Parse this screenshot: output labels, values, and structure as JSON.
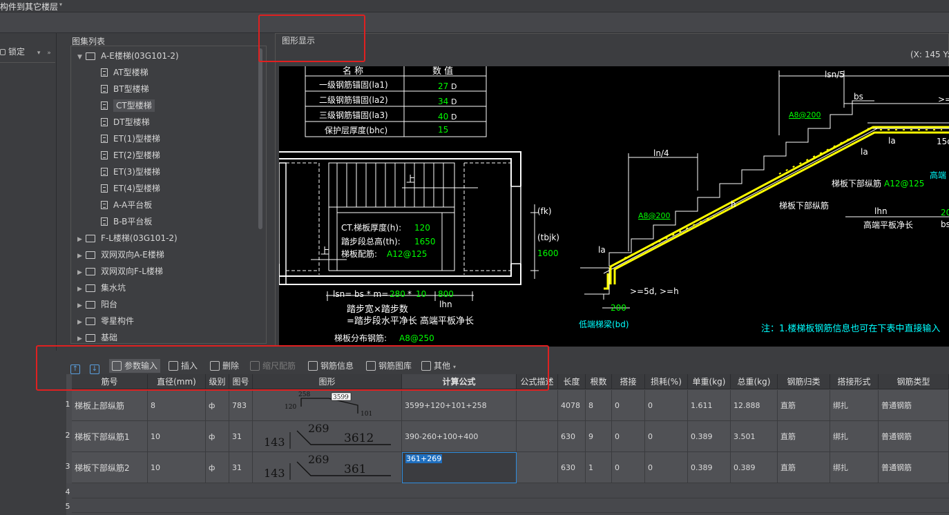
{
  "topbar": {
    "title": "构件到其它楼层"
  },
  "left": {
    "lock_label": "锁定"
  },
  "tree": {
    "title": "图集列表",
    "items": [
      {
        "label": "A-E楼梯(03G101-2)",
        "kind": "folder",
        "expanded": true
      },
      {
        "label": "AT型楼梯",
        "kind": "doc"
      },
      {
        "label": "BT型楼梯",
        "kind": "doc"
      },
      {
        "label": "CT型楼梯",
        "kind": "doc",
        "selected": true
      },
      {
        "label": "DT型楼梯",
        "kind": "doc"
      },
      {
        "label": "ET(1)型楼梯",
        "kind": "doc"
      },
      {
        "label": "ET(2)型楼梯",
        "kind": "doc"
      },
      {
        "label": "ET(3)型楼梯",
        "kind": "doc"
      },
      {
        "label": "ET(4)型楼梯",
        "kind": "doc"
      },
      {
        "label": "A-A平台板",
        "kind": "doc"
      },
      {
        "label": "B-B平台板",
        "kind": "doc"
      },
      {
        "label": "F-L楼梯(03G101-2)",
        "kind": "folder"
      },
      {
        "label": "双网双向A-E楼梯",
        "kind": "folder"
      },
      {
        "label": "双网双向F-L楼梯",
        "kind": "folder"
      },
      {
        "label": "集水坑",
        "kind": "folder"
      },
      {
        "label": "阳台",
        "kind": "folder"
      },
      {
        "label": "零星构件",
        "kind": "folder"
      },
      {
        "label": "基础",
        "kind": "folder"
      }
    ]
  },
  "graphics": {
    "title": "图形显示",
    "coord": "(X: 145 Y:",
    "param_table": {
      "headers": [
        "名 称",
        "数 值"
      ],
      "rows": [
        {
          "name": "一级钢筋锚固(la1)",
          "value": "27",
          "unit": "D"
        },
        {
          "name": "二级钢筋锚固(la2)",
          "value": "34",
          "unit": "D"
        },
        {
          "name": "三级钢筋锚固(la3)",
          "value": "40",
          "unit": "D"
        },
        {
          "name": "保护层厚度(bhc)",
          "value": "15",
          "unit": ""
        }
      ]
    },
    "plan": {
      "up1": "上",
      "up2": "上",
      "thick_label": "CT.梯板厚度(h):",
      "thick_value": "120",
      "height_label": "踏步段总高(th):",
      "height_value": "1650",
      "rebar_label": "梯板配筋:",
      "rebar_value": "A12@125",
      "lsn_formula": "lsn= bs * m=",
      "bs_value": "280",
      "times": "*",
      "m_value": "10",
      "lhn_value": "800",
      "lhn_label": "lhn",
      "step_text": "踏步宽×踏步数",
      "net_text": "=踏步段水平净长 高端平板净长",
      "dist_label": "梯板分布钢筋:",
      "dist_value": "A8@250",
      "fk": "(fk)",
      "tbjk": "(tbjk)",
      "v1600": "1600"
    },
    "section": {
      "lsn5": "lsn/5",
      "bs": "bs",
      "gt": ">=",
      "a8_top": "A8@200",
      "ln4": "ln/4",
      "la1": "la",
      "la2": "la",
      "la3": "la",
      "v15": "15d",
      "high": "高端",
      "lower_rebar": "梯板下部纵筋",
      "lower_rebar_val": "A12@125",
      "lower_rebar2": "梯板下部纵筋",
      "lhn": "lhn",
      "v20": "20",
      "high_net": "高端平板净长",
      "bs2": "bs",
      "a8_left": "A8@200",
      "h": "h",
      "la4": "la",
      "v5d": ">=5d, >=h",
      "v200": "200",
      "low_beam": "低端梯梁(bd)",
      "note": "注：1.楼梯板钢筋信息也可在下表中直接输入"
    }
  },
  "toolbar": {
    "up_icon": "↑",
    "down_icon": "↓",
    "param_input": "参数输入",
    "insert": "插入",
    "delete": "删除",
    "scale_rebar": "缩尺配筋",
    "rebar_info": "钢筋信息",
    "rebar_lib": "钢筋图库",
    "other": "其他"
  },
  "table": {
    "headers": [
      "筋号",
      "直径(mm)",
      "级别",
      "图号",
      "图形",
      "计算公式",
      "公式描述",
      "长度",
      "根数",
      "搭接",
      "损耗(%)",
      "单重(kg)",
      "总重(kg)",
      "钢筋归类",
      "搭接形式",
      "钢筋类型"
    ],
    "rows": [
      {
        "num": "1",
        "name": "梯板上部纵筋",
        "dia": "8",
        "grade": "ф",
        "fig": "783",
        "shape": {
          "a": "258",
          "b": "3599",
          "c": "120",
          "d": "101"
        },
        "formula": "3599+120+101+258",
        "desc": "",
        "len": "4078",
        "count": "8",
        "lap": "0",
        "loss": "0",
        "unit_w": "1.611",
        "total_w": "12.888",
        "cat": "直筋",
        "lap_type": "绑扎",
        "type": "普通钢筋"
      },
      {
        "num": "2",
        "name": "梯板下部纵筋1",
        "dia": "10",
        "grade": "ф",
        "fig": "31",
        "shape": {
          "a": "143",
          "b": "269",
          "c": "3612"
        },
        "formula": "390-260+100+400",
        "desc": "",
        "len": "630",
        "count": "9",
        "lap": "0",
        "loss": "0",
        "unit_w": "0.389",
        "total_w": "3.501",
        "cat": "直筋",
        "lap_type": "绑扎",
        "type": "普通钢筋"
      },
      {
        "num": "3",
        "name": "梯板下部纵筋2",
        "dia": "10",
        "grade": "ф",
        "fig": "31",
        "shape": {
          "a": "143",
          "b": "269",
          "c": "361"
        },
        "formula": "361+269",
        "desc": "",
        "len": "630",
        "count": "1",
        "lap": "0",
        "loss": "0",
        "unit_w": "0.389",
        "total_w": "0.389",
        "cat": "直筋",
        "lap_type": "绑扎",
        "type": "普通钢筋"
      }
    ],
    "empty_rows": [
      "4",
      "5"
    ]
  },
  "colors": {
    "accent_red": "#e02020",
    "rebar_yellow": "#ffff00",
    "cad_green": "#00ff00",
    "cad_cyan": "#00ffff",
    "edit_blue": "#2f8ee0"
  }
}
